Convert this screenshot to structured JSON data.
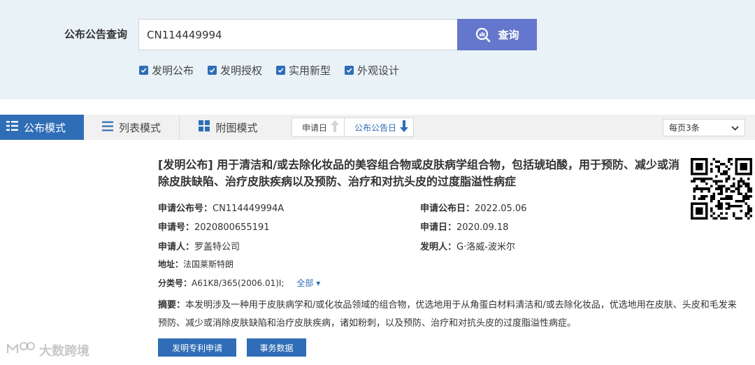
{
  "search": {
    "label": "公布公告查询",
    "query": "CN114449994",
    "button_label": "查询",
    "options": [
      {
        "label": "发明公布",
        "checked": true
      },
      {
        "label": "发明授权",
        "checked": true
      },
      {
        "label": "实用新型",
        "checked": true
      },
      {
        "label": "外观设计",
        "checked": true
      }
    ]
  },
  "toolbar": {
    "modes": [
      {
        "label": "公布模式",
        "active": true,
        "icon": "list-detail-icon"
      },
      {
        "label": "列表模式",
        "active": false,
        "icon": "list-lines-icon"
      },
      {
        "label": "附图模式",
        "active": false,
        "icon": "grid-icon"
      }
    ],
    "sort": [
      {
        "label": "申请日",
        "arrow": "up",
        "active": false
      },
      {
        "label": "公布公告日",
        "arrow": "down",
        "active": true
      }
    ],
    "page_size": "每页3条"
  },
  "result": {
    "title": "[发明公布] 用于清洁和/或去除化妆品的美容组合物或皮肤病学组合物，包括琥珀酸，用于预防、减少或消除皮肤缺陷、治疗皮肤疾病以及预防、治疗和对抗头皮的过度脂溢性病症",
    "pub_no_label": "申请公布号：",
    "pub_no": "CN114449994A",
    "pub_date_label": "申请公布日：",
    "pub_date": "2022.05.06",
    "app_no_label": "申请号：",
    "app_no": "2020800655191",
    "app_date_label": "申请日：",
    "app_date": "2020.09.18",
    "applicant_label": "申请人：",
    "applicant": "罗盖特公司",
    "inventor_label": "发明人：",
    "inventor": "G·洛威-波米尔",
    "address_label": "地址：",
    "address": "法国莱斯特朗",
    "class_label": "分类号：",
    "class_value": "A61K8/365(2006.01)I;",
    "class_more": "全部",
    "abstract_label": "摘要：",
    "abstract": "本发明涉及一种用于皮肤病学和/或化妆品领域的组合物，优选地用于从角蛋白材料清洁和/或去除化妆品，优选地用在皮肤、头皮和毛发来预防、减少或消除皮肤缺陷和治疗皮肤疾病，诸如粉刺，以及预防、治疗和对抗头皮的过度脂溢性病症。",
    "actions": [
      "发明专利申请",
      "事务数据"
    ]
  },
  "watermark": "大数跨境",
  "colors": {
    "accent": "#2f6db6",
    "search_button": "#6577cc",
    "panel_bg": "#e9f2f7"
  }
}
